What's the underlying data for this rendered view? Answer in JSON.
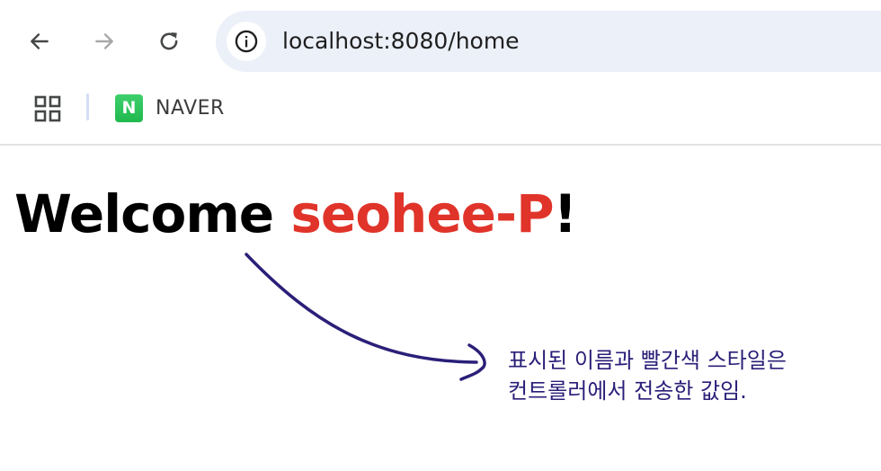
{
  "browser": {
    "url": "localhost:8080/home",
    "bookmarks": [
      {
        "label": "NAVER",
        "icon": "naver-n-icon",
        "logo_letter": "N"
      }
    ]
  },
  "page": {
    "heading_prefix": "Welcome ",
    "heading_name": "seohee-P",
    "heading_suffix": "!",
    "name_color": "#e0342a"
  },
  "annotation": {
    "line1": "표시된  이름과 빨간색 스타일은",
    "line2": "컨트롤러에서 전송한 값임.",
    "color": "#2a1f78"
  }
}
